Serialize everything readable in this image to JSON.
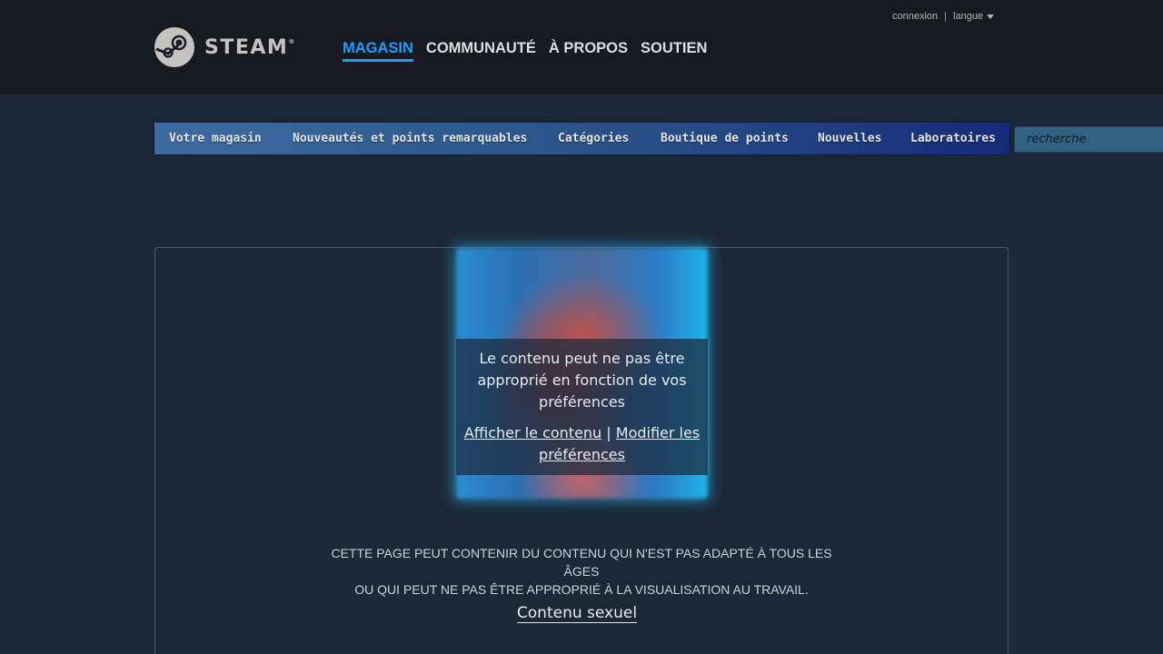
{
  "header": {
    "logo_text": "STEAM",
    "logo_mark": "®",
    "nav": [
      "MAGASIN",
      "COMMUNAUTÉ",
      "À PROPOS",
      "SOUTIEN"
    ],
    "login": "connexion",
    "separator": "|",
    "language": "langue"
  },
  "store_nav": {
    "tabs": [
      "Votre magasin",
      "Nouveautés et points remarquables",
      "Catégories",
      "Boutique de points",
      "Nouvelles",
      "Laboratoires"
    ],
    "search_placeholder": "recherche"
  },
  "content": {
    "overlay_message": "Le contenu peut ne pas être approprié en fonction de vos préférences",
    "show_content": "Afficher le contenu",
    "links_separator": "|",
    "modify_preferences": "Modifier les préférences",
    "warning_line1": "Cette page peut contenir du contenu qui n'est pas adapté à tous les âges",
    "warning_line2": "ou qui peut ne pas être approprié à la visualisation au travail.",
    "descriptor": "Contenu sexuel"
  },
  "colors": {
    "background": "#1b2838",
    "header_bg": "#171a21",
    "accent": "#1a9fff"
  },
  "icons": {
    "logo": "steam-logo-icon",
    "language": "chevron-down-icon"
  }
}
